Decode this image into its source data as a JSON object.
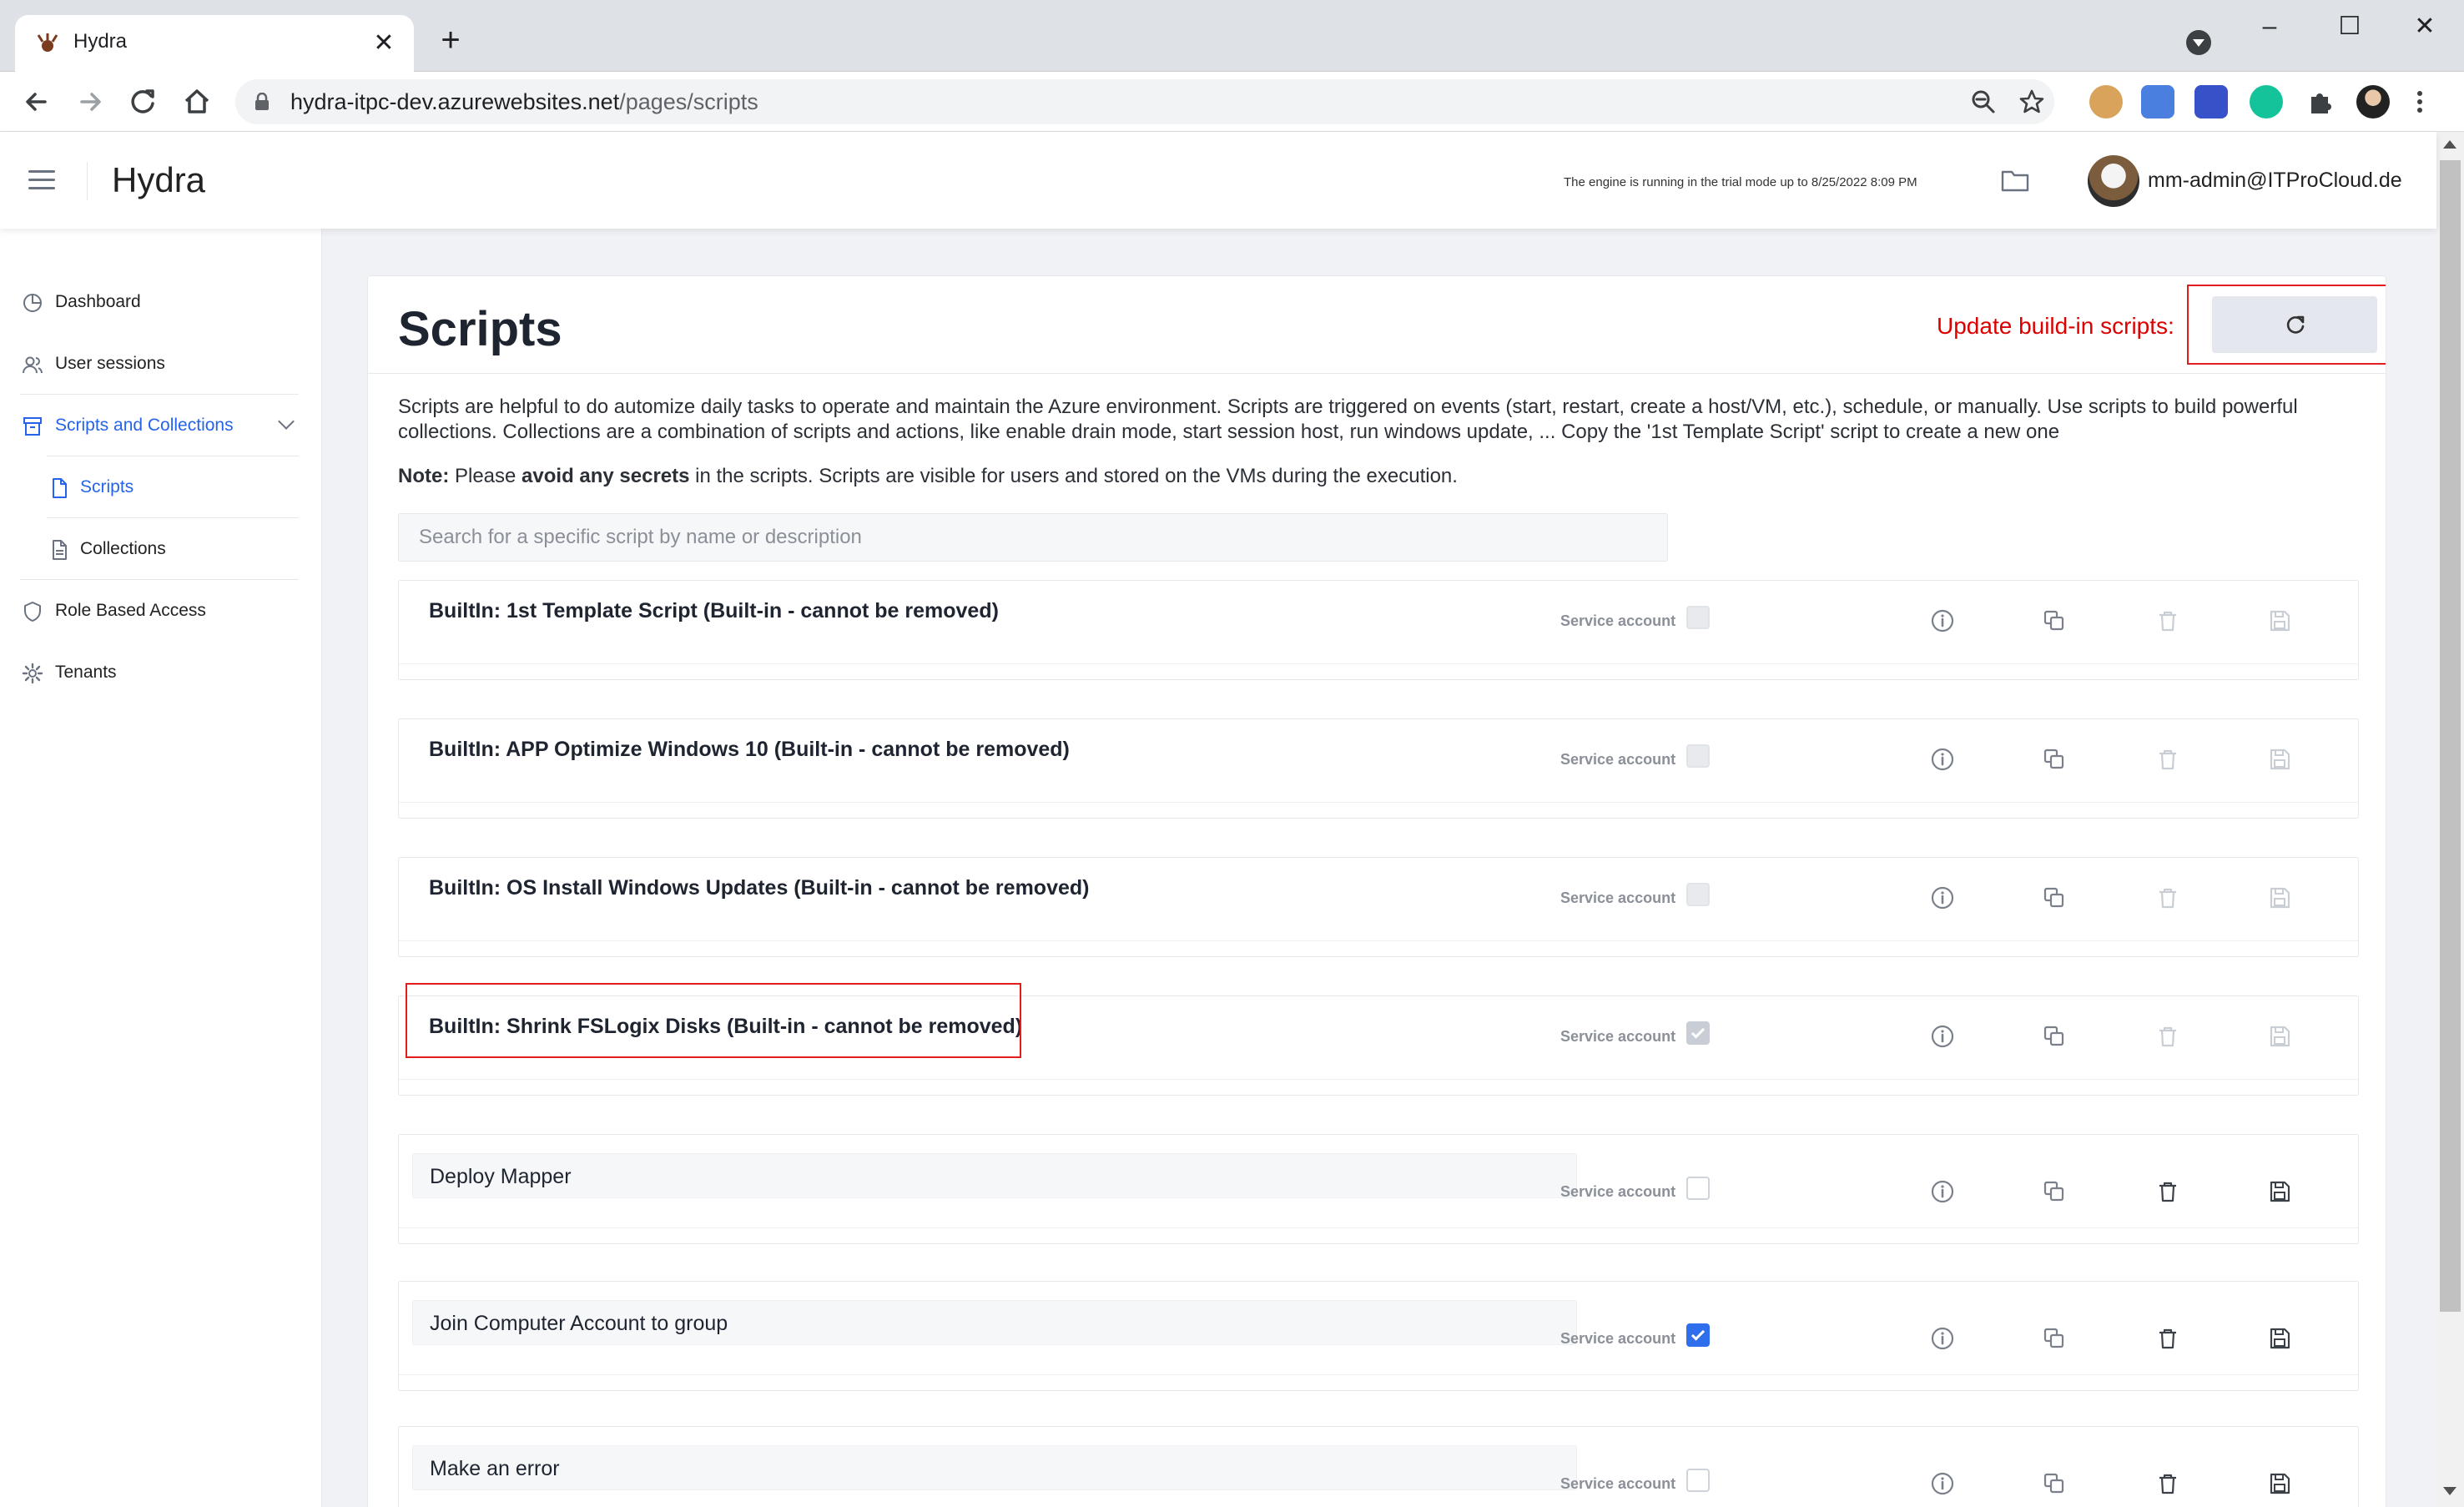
{
  "browser": {
    "tab_title": "Hydra",
    "tab_close": "✕",
    "new_tab": "+",
    "url_host": "hydra-itpc-dev.azurewebsites.net",
    "url_path": "/pages/scripts",
    "win_minimize": "–",
    "win_maximize": "☐",
    "win_close": "✕"
  },
  "header": {
    "app_title": "Hydra",
    "trial_notice": "The engine is running in the trial mode up to 8/25/2022 8:09 PM",
    "user": "mm-admin@ITProCloud.de"
  },
  "sidebar": {
    "items": [
      {
        "label": "Dashboard",
        "icon": "pie-chart-icon"
      },
      {
        "label": "User sessions",
        "icon": "users-icon"
      },
      {
        "label": "Scripts and Collections",
        "icon": "archive-icon"
      },
      {
        "label": "Scripts",
        "icon": "file-icon"
      },
      {
        "label": "Collections",
        "icon": "file-text-icon"
      },
      {
        "label": "Role Based Access",
        "icon": "shield-icon"
      },
      {
        "label": "Tenants",
        "icon": "gear-icon"
      }
    ],
    "active": "Scripts"
  },
  "main": {
    "title": "Scripts",
    "update_label": "Update build-in scripts:",
    "description": "Scripts are helpful to do automize daily tasks to operate and maintain the Azure environment. Scripts are triggered on events (start, restart, create a host/VM, etc.), schedule, or manually. Use scripts to build powerful collections. Collections are a combination of scripts and actions, like enable drain mode, start session host, run windows update, ... Copy the '1st Template Script' script to create a new one",
    "note_prefix": "Note:",
    "note_mid1": " Please ",
    "note_bold": "avoid any secrets",
    "note_mid2": " in the scripts. Scripts are visible for users and stored on the VMs during the execution.",
    "search_placeholder": "Search for a specific script by name or description",
    "service_account_label": "Service account",
    "scripts": [
      {
        "name": "BuiltIn: 1st Template Script (Built-in - cannot be removed)",
        "builtin": true,
        "service_account": false
      },
      {
        "name": "BuiltIn: APP Optimize Windows 10 (Built-in - cannot be removed)",
        "builtin": true,
        "service_account": false
      },
      {
        "name": "BuiltIn: OS Install Windows Updates (Built-in - cannot be removed)",
        "builtin": true,
        "service_account": false
      },
      {
        "name": "BuiltIn: Shrink FSLogix Disks (Built-in - cannot be removed)",
        "builtin": true,
        "service_account": true
      },
      {
        "name": "Deploy Mapper",
        "builtin": false,
        "service_account": false
      },
      {
        "name": "Join Computer Account to group",
        "builtin": false,
        "service_account": true
      },
      {
        "name": "Make an error",
        "builtin": false,
        "service_account": false
      }
    ]
  },
  "colors": {
    "accent": "#2563eb",
    "checkbox_checked": "#2f6fed",
    "highlight": "#e11d1d"
  }
}
